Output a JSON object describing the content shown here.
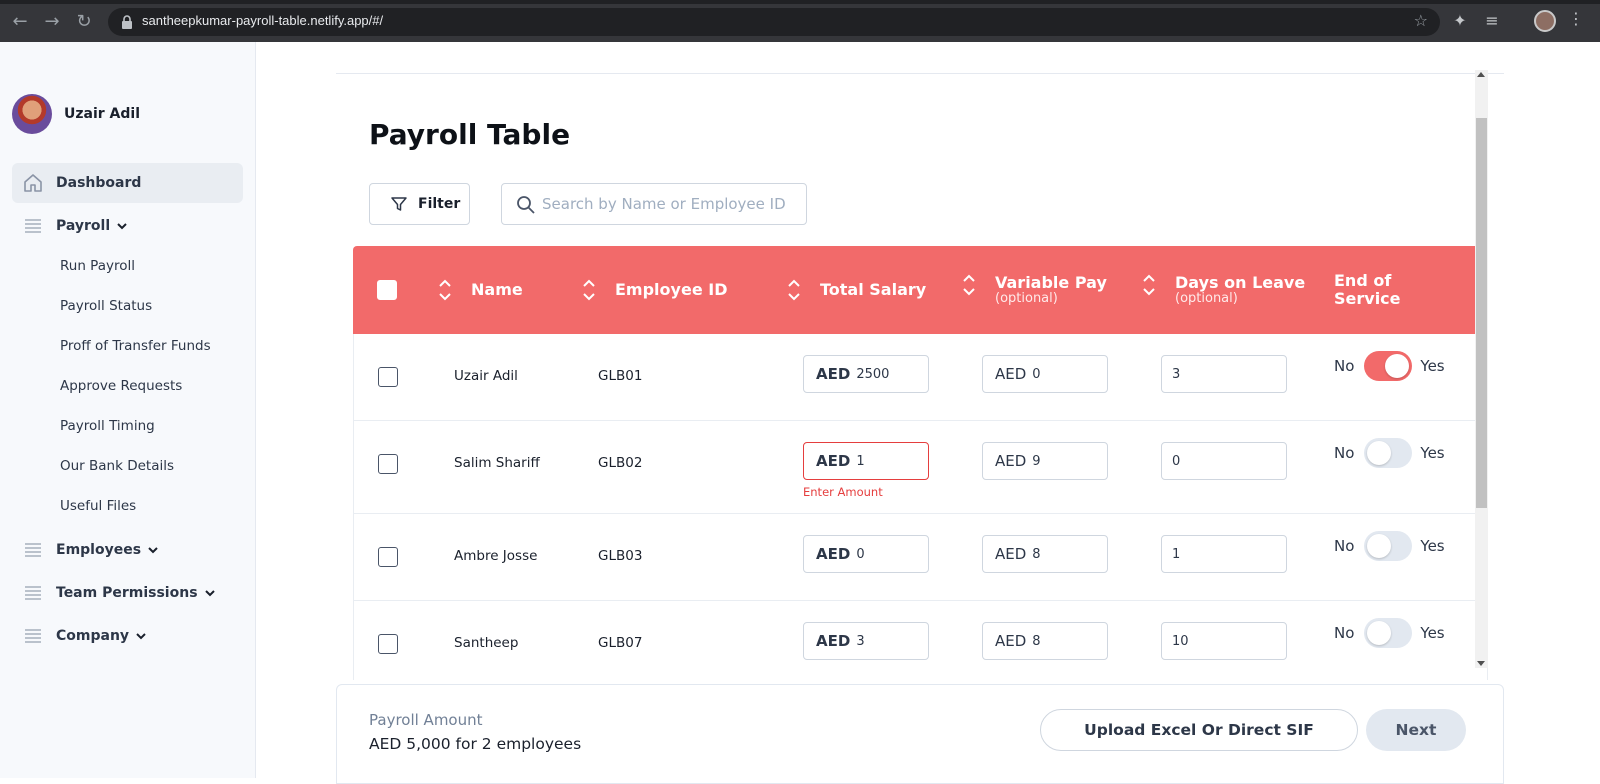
{
  "browser": {
    "url": "santheepkumar-payroll-table.netlify.app/#/"
  },
  "sidebar": {
    "user_name": "Uzair Adil",
    "items": [
      {
        "label": "Dashboard",
        "icon": "home-icon"
      },
      {
        "label": "Payroll",
        "icon": "list-icon"
      },
      {
        "label": "Employees",
        "icon": "list-icon"
      },
      {
        "label": "Team Permissions",
        "icon": "list-icon"
      },
      {
        "label": "Company",
        "icon": "list-icon"
      }
    ],
    "payroll_sub": [
      "Run Payroll",
      "Payroll Status",
      "Proff of Transfer Funds",
      "Approve Requests",
      "Payroll Timing",
      "Our Bank Details",
      "Useful Files"
    ]
  },
  "main": {
    "title": "Payroll Table",
    "filter_label": "Filter",
    "search_placeholder": "Search by Name or Employee ID",
    "columns": {
      "name": "Name",
      "employee_id": "Employee ID",
      "total_salary": "Total Salary",
      "variable_pay": "Variable Pay",
      "variable_pay_sub": "(optional)",
      "days_on_leave": "Days on Leave",
      "days_on_leave_sub": "(optional)",
      "end_of_service_1": "End of",
      "end_of_service_2": "Service"
    },
    "currency": "AED",
    "toggle_no": "No",
    "toggle_yes": "Yes",
    "rows": [
      {
        "name": "Uzair Adil",
        "id": "GLB01",
        "salary": "2500",
        "variable": "0",
        "leave": "3",
        "eos": true,
        "error": ""
      },
      {
        "name": "Salim Shariff",
        "id": "GLB02",
        "salary": "1",
        "variable": "9",
        "leave": "0",
        "eos": false,
        "error": "Enter Amount"
      },
      {
        "name": "Ambre Josse",
        "id": "GLB03",
        "salary": "0",
        "variable": "8",
        "leave": "1",
        "eos": false,
        "error": ""
      },
      {
        "name": "Santheep",
        "id": "GLB07",
        "salary": "3",
        "variable": "8",
        "leave": "10",
        "eos": false,
        "error": ""
      }
    ]
  },
  "footer": {
    "title": "Payroll Amount",
    "value": "AED 5,000 for 2 employees",
    "upload_label": "Upload Excel Or Direct SIF",
    "next_label": "Next"
  },
  "colors": {
    "accent": "#f26a6a",
    "error": "#e53e3e"
  }
}
